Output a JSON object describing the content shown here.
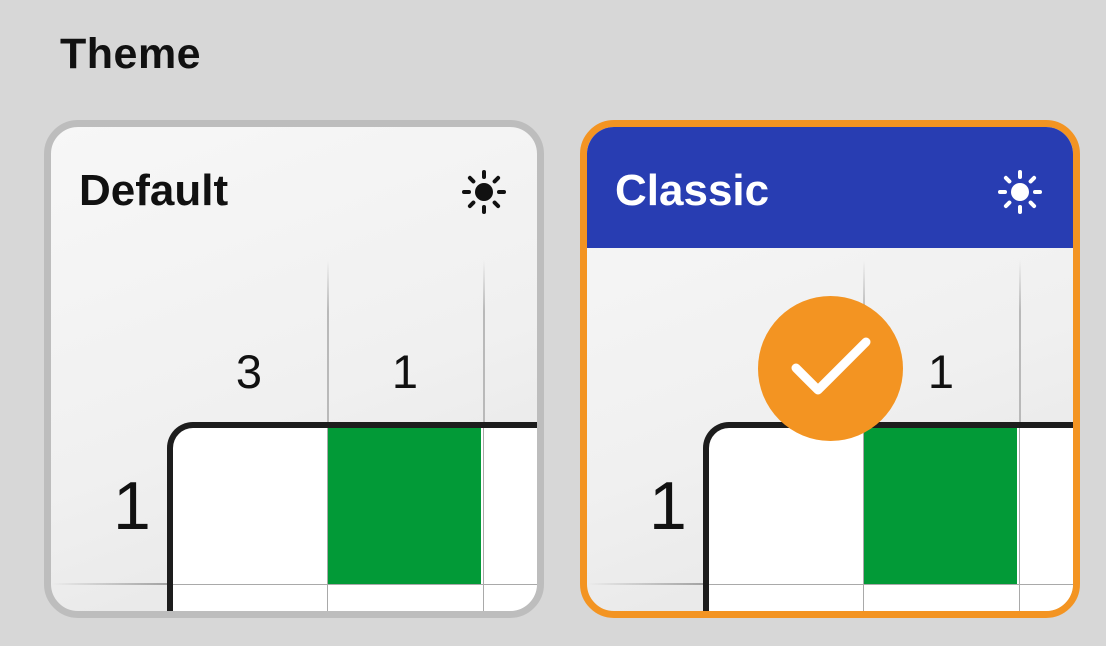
{
  "section": {
    "title": "Theme"
  },
  "themes": [
    {
      "name": "Default",
      "mode_icon": "sun-icon",
      "selected": false,
      "header_color": "#f2f2f2",
      "border_color": "#bdbdbd",
      "preview": {
        "column_clues": [
          "3",
          "1"
        ],
        "row_clues": [
          "1"
        ],
        "filled_color": "#029a37"
      }
    },
    {
      "name": "Classic",
      "mode_icon": "sun-icon",
      "selected": true,
      "header_color": "#283db2",
      "border_color": "#f39422",
      "preview": {
        "column_clues": [
          "1"
        ],
        "row_clues": [
          "1"
        ],
        "filled_color": "#029a37"
      }
    }
  ],
  "selected_badge": {
    "icon": "checkmark-icon",
    "color": "#f39422"
  }
}
